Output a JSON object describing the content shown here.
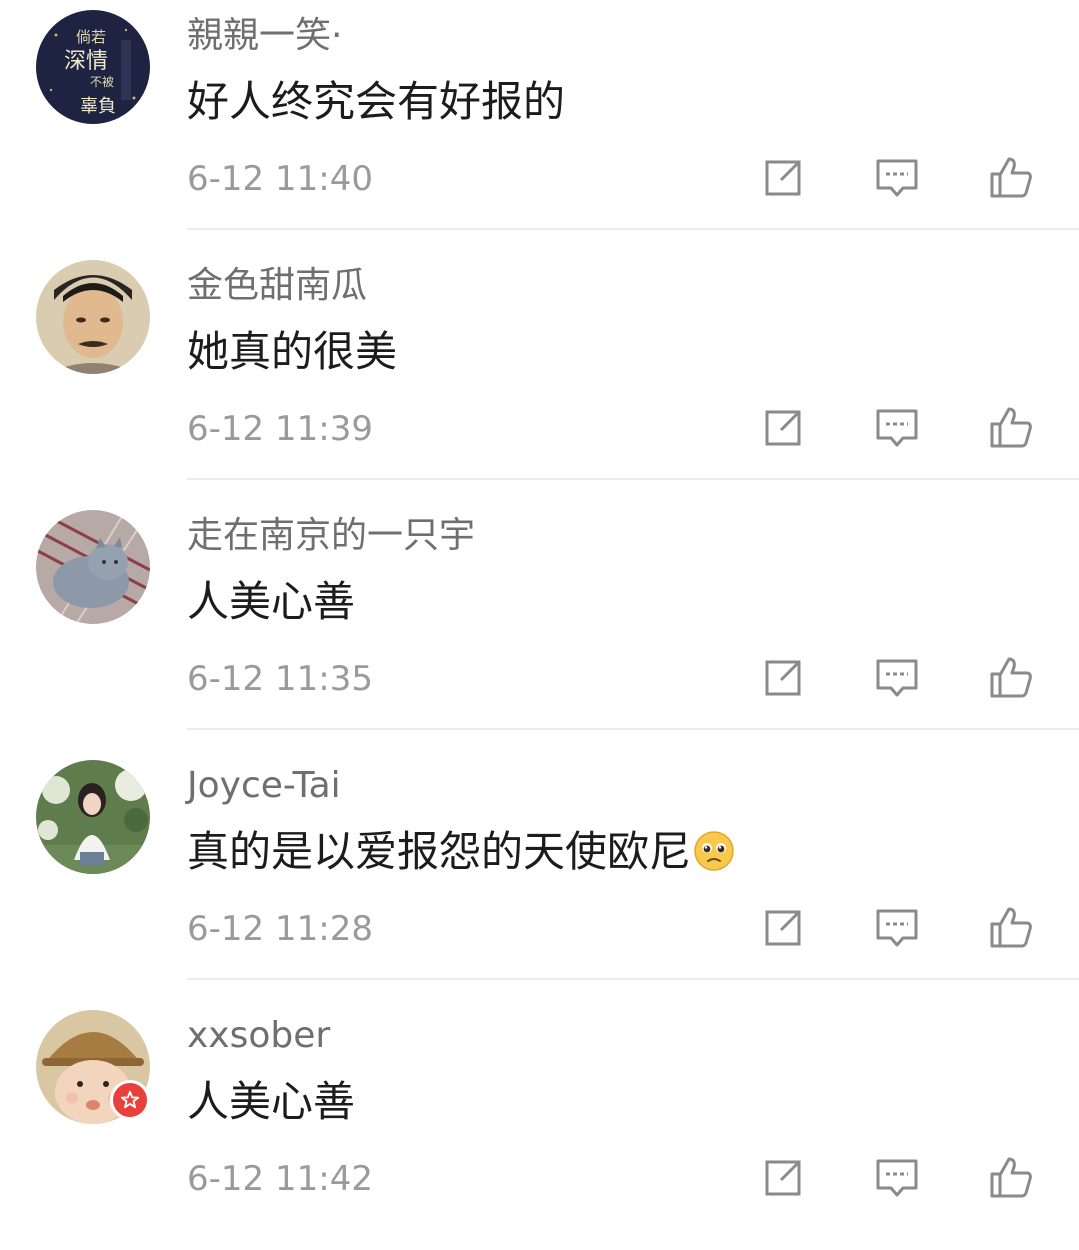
{
  "comments": [
    {
      "username": "親親一笑·",
      "text": "好人终究会有好报的",
      "time": "6-12 11:40"
    },
    {
      "username": "金色甜南瓜",
      "text": "她真的很美",
      "time": "6-12 11:39"
    },
    {
      "username": "走在南京的一只宇",
      "text": "人美心善",
      "time": "6-12 11:35"
    },
    {
      "username": "Joyce-Tai",
      "text": "真的是以爱报怨的天使欧尼",
      "time": "6-12 11:28",
      "emoji": "pleading-face"
    },
    {
      "username": "xxsober",
      "text": "人美心善",
      "time": "6-12 11:42",
      "badge": "red-star-badge"
    }
  ],
  "avatar_1_text": [
    "倘若",
    "深情",
    "不被",
    "辜負"
  ],
  "icons": {
    "share": "edit-share-icon",
    "reply": "comment-bubble-icon",
    "like": "thumbs-up-icon"
  },
  "colors": {
    "username": "#6f6f6f",
    "text": "#1c1c1c",
    "time": "#9a9a9a",
    "icon": "#8a8a8a",
    "divider": "#ebebeb",
    "badge": "#e8403a"
  }
}
